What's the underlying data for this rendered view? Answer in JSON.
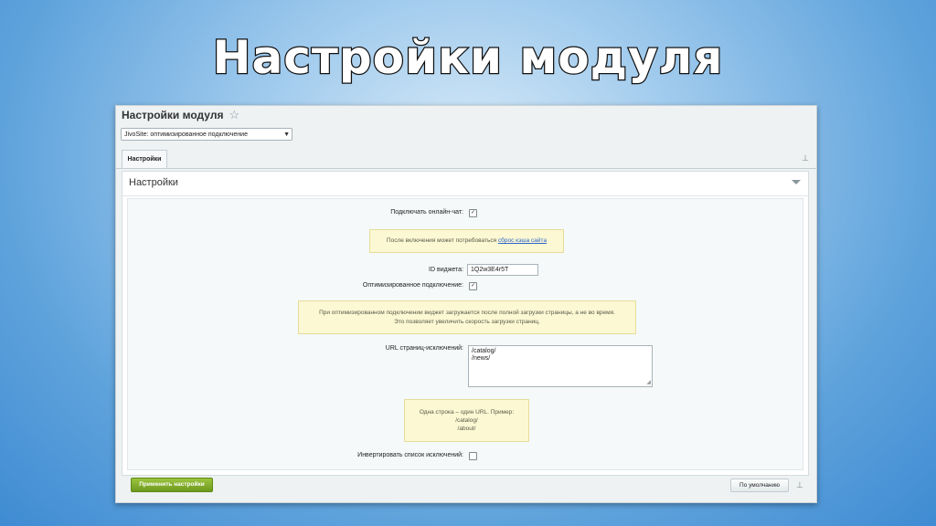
{
  "slide": {
    "title": "Настройки модуля"
  },
  "window": {
    "title": "Настройки модуля",
    "module_select": {
      "value": "JivoSite: оптимизированное подключение"
    },
    "tabs": [
      {
        "label": "Настройки"
      }
    ]
  },
  "panel": {
    "title": "Настройки",
    "fields": {
      "online_chat_label": "Подключать онлайн-чат:",
      "online_chat_checked": true,
      "note1_text": "После включения может потребоваться",
      "note1_link": "сброс кэша сайта",
      "widget_id_label": "ID виджета:",
      "widget_id_value": "1Q2w3E4r5T",
      "optimized_label": "Оптимизированное подключение:",
      "optimized_checked": true,
      "note2_line1": "При оптимизированном подключении виджет загружается после полной загрузки страницы, а не во время.",
      "note2_line2": "Это позволяет увеличить скорость загрузки страниц.",
      "exclusions_label": "URL страниц-исключений:",
      "exclusions_lines": [
        "/catalog/",
        "/news/"
      ],
      "note3_line1": "Одна строка – один URL. Пример:",
      "note3_line2": "/catalog/",
      "note3_line3": "/about/",
      "invert_label": "Инвертировать список исключений:",
      "invert_checked": false
    }
  },
  "footer": {
    "apply_label": "Применить настройки",
    "default_label": "По умолчанию"
  },
  "icons": {
    "star": "star-icon",
    "pin": "pin-icon",
    "collapse": "triangle-down-icon",
    "check": "checkmark-icon"
  }
}
